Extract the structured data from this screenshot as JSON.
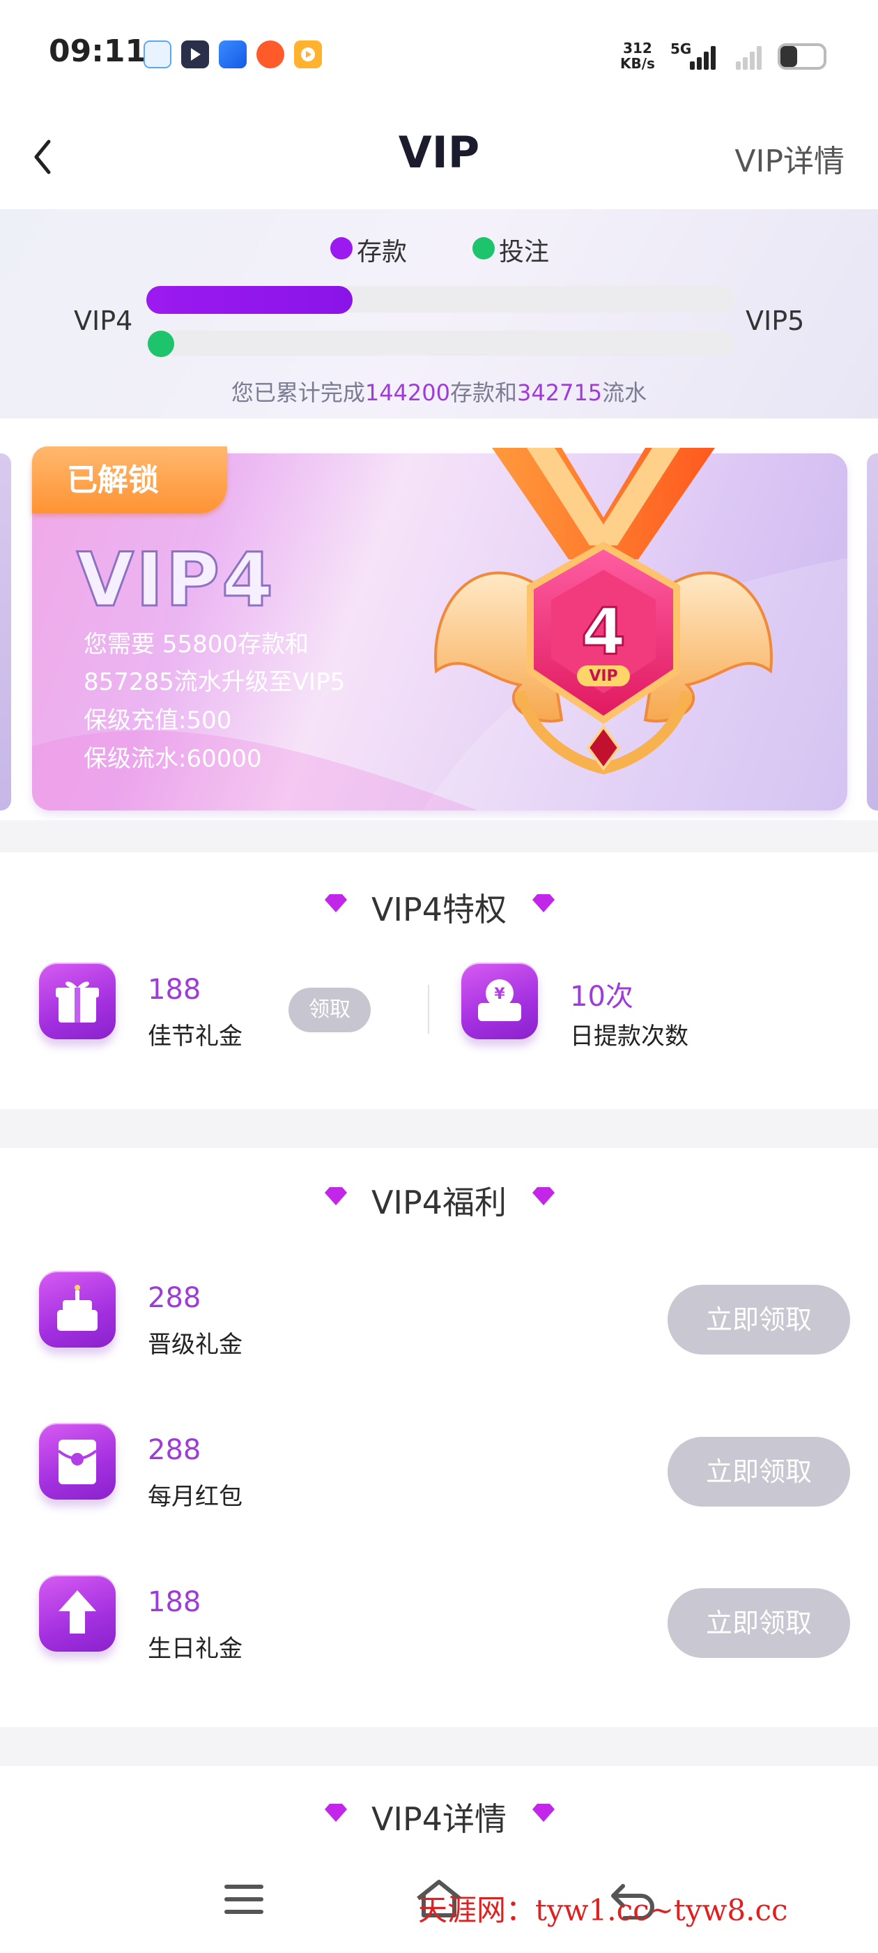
{
  "status_bar": {
    "time": "09:11",
    "net_speed_top": "312",
    "net_speed_bottom": "KB/s",
    "network": "5G"
  },
  "nav": {
    "back_icon": "chevron-left-icon",
    "title": "VIP",
    "details_link": "VIP详情"
  },
  "progress": {
    "legend_deposit": "存款",
    "legend_bet": "投注",
    "current_level": "VIP4",
    "next_level": "VIP5",
    "deposit_fill": 0.35,
    "bet_fill": 0.0,
    "summary_prefix": "您已累计完成",
    "summary_deposit": "144200",
    "summary_mid": "存款和",
    "summary_turnover": "342715",
    "summary_suffix": "流水",
    "colors": {
      "deposit": "#9b1af0",
      "bet": "#1ec46b"
    }
  },
  "card": {
    "badge": "已解锁",
    "level": "VIP4",
    "line1": "您需要 55800存款和",
    "line2": "857285流水升级至VIP5",
    "line3": "保级充值:500",
    "line4": "保级流水:60000",
    "medal_number": "4",
    "medal_tag": "VIP"
  },
  "privileges": {
    "heading": "VIP4特权",
    "items": [
      {
        "value": "188",
        "label": "佳节礼金",
        "button": "领取",
        "icon": "gift-icon"
      },
      {
        "value": "10次",
        "label": "日提款次数",
        "icon": "withdraw-icon"
      }
    ]
  },
  "benefits": {
    "heading": "VIP4福利",
    "items": [
      {
        "value": "288",
        "label": "晋级礼金",
        "button": "立即领取",
        "icon": "cake-icon"
      },
      {
        "value": "288",
        "label": "每月红包",
        "button": "立即领取",
        "icon": "red-envelope-icon"
      },
      {
        "value": "188",
        "label": "生日礼金",
        "button": "立即领取",
        "icon": "arrow-up-icon"
      }
    ]
  },
  "details": {
    "heading": "VIP4详情"
  },
  "bottom_nav": {
    "menu_icon": "menu-icon",
    "home_icon": "home-icon",
    "back_icon": "back-icon",
    "watermark": "天涯网：tyw1.cc~tyw8.cc"
  }
}
